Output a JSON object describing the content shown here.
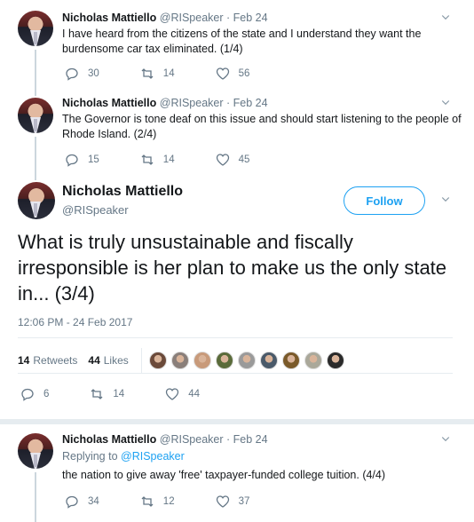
{
  "tweets": [
    {
      "name": "Nicholas Mattiello",
      "handle": "@RISpeaker",
      "dot": "·",
      "date": "Feb 24",
      "text": "I have heard from the citizens of the state and I understand they want the burdensome car tax eliminated.  (1/4)",
      "replies": "30",
      "retweets": "14",
      "likes": "56"
    },
    {
      "name": "Nicholas Mattiello",
      "handle": "@RISpeaker",
      "dot": "·",
      "date": "Feb 24",
      "text": "The Governor is tone deaf on this issue and should start listening to the people of Rhode Island. (2/4)",
      "replies": "15",
      "retweets": "14",
      "likes": "45"
    }
  ],
  "main": {
    "name": "Nicholas Mattiello",
    "handle": "@RISpeaker",
    "follow_label": "Follow",
    "text": "What is truly unsustainable and fiscally irresponsible is her plan to make us the only state in... (3/4)",
    "timestamp": "12:06 PM - 24 Feb 2017",
    "retweets_count": "14",
    "retweets_label": "Retweets",
    "likes_count": "44",
    "likes_label": "Likes",
    "replies": "6",
    "retweets": "14",
    "likes": "44"
  },
  "reply_tweet": {
    "name": "Nicholas Mattiello",
    "handle": "@RISpeaker",
    "dot": "·",
    "date": "Feb 24",
    "replying_prefix": "Replying to",
    "replying_handle": "@RISpeaker",
    "text": "the nation to give away 'free' taxpayer-funded college tuition. (4/4)",
    "replies": "34",
    "retweets": "12",
    "likes": "37"
  },
  "liker_avatar_colors": [
    "#6b4a3a",
    "#8a7f7a",
    "#c89a7a",
    "#5a6b3a",
    "#9a9a9a",
    "#4a5a6a",
    "#7a5a2a",
    "#aaa89a",
    "#2a2a2a"
  ],
  "colors": {
    "accent": "#1da1f2",
    "muted": "#657786",
    "text": "#14171a",
    "divider": "#e6ecf0"
  }
}
